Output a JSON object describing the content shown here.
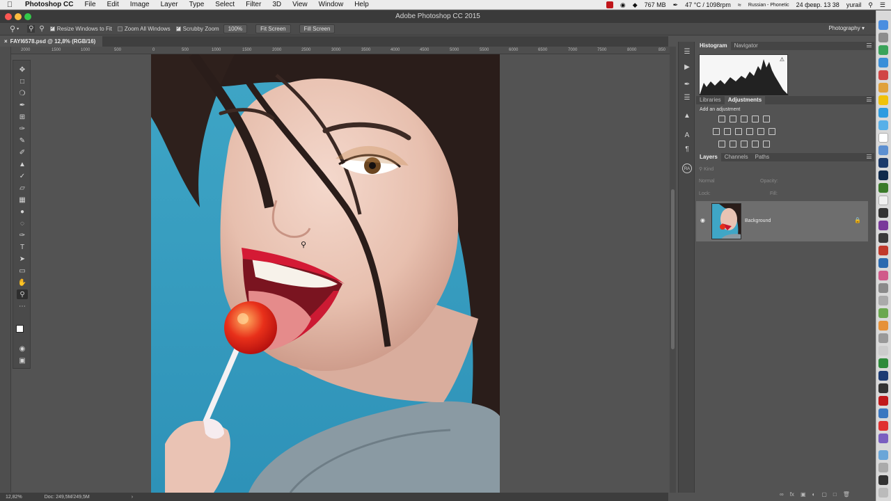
{
  "menubar": {
    "app_name": "Photoshop CC",
    "items": [
      "File",
      "Edit",
      "Image",
      "Layer",
      "Type",
      "Select",
      "Filter",
      "3D",
      "View",
      "Window",
      "Help"
    ],
    "memory": "767 MB",
    "temp": "47 °C / 1098rpm",
    "keyboard": "Russian - Phonetic",
    "datetime": "24 февр. 13 38",
    "user": "yurail"
  },
  "window": {
    "title": "Adobe Photoshop CC 2015"
  },
  "options": {
    "resize_windows": "Resize Windows to Fit",
    "zoom_all": "Zoom All Windows",
    "scrubby": "Scrubby Zoom",
    "btn_100": "100%",
    "btn_fit": "Fit Screen",
    "btn_fill": "Fill Screen",
    "workspace": "Photography"
  },
  "document": {
    "tab": "FAYI6578.psd @ 12,8% (RGB/16)"
  },
  "ruler_labels": [
    "2000",
    "1500",
    "1000",
    "500",
    "0",
    "500",
    "1000",
    "1500",
    "2000",
    "2500",
    "3000",
    "3500",
    "4000",
    "4500",
    "5000",
    "5500",
    "6000",
    "6500",
    "7000",
    "7500",
    "8000",
    "850"
  ],
  "status": {
    "zoom": "12,82%",
    "doc": "Doc: 249,5M/249,5M"
  },
  "panels": {
    "top_tabs": [
      "Histogram",
      "Navigator"
    ],
    "mid_tabs": [
      "Libraries",
      "Adjustments"
    ],
    "add_adjustment": "Add an adjustment",
    "layer_tabs": [
      "Layers",
      "Channels",
      "Paths"
    ],
    "kind": "Kind",
    "blend": "Normal",
    "opacity": "Opacity:",
    "lock": "Lock:",
    "fill": "Fill:",
    "layer_name": "Background"
  },
  "colors": {
    "menubar": "#ececec",
    "chrome": "#535353",
    "accent_red": "#d21c1c"
  }
}
